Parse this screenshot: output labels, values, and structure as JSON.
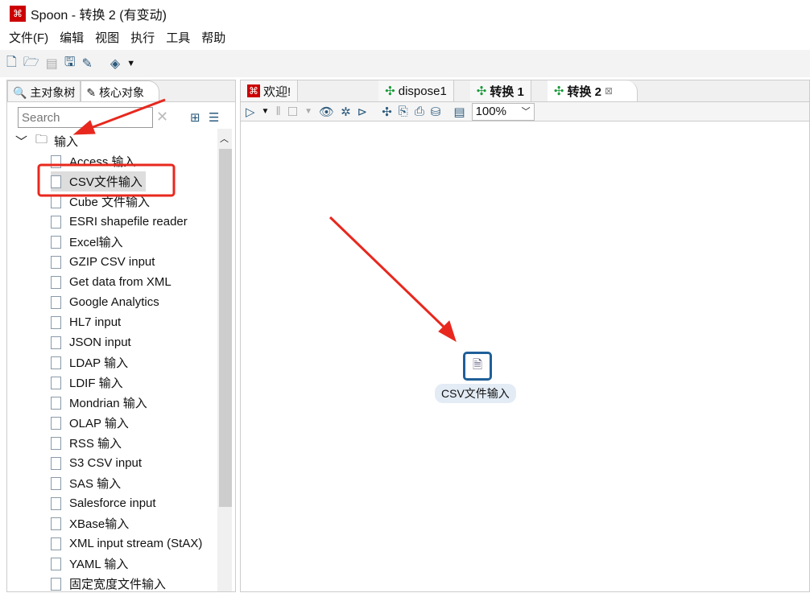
{
  "window": {
    "title": "Spoon - 转换 2 (有变动)"
  },
  "menu": [
    "文件(F)",
    "编辑",
    "视图",
    "执行",
    "工具",
    "帮助"
  ],
  "left_tabs": [
    "主对象树",
    "核心对象"
  ],
  "search": {
    "placeholder": "Search"
  },
  "tree": {
    "folder": "输入",
    "items": [
      "Access 输入",
      "CSV文件输入",
      "Cube 文件输入",
      "ESRI shapefile reader",
      "Excel输入",
      "GZIP CSV input",
      "Get data from XML",
      "Google Analytics",
      "HL7 input",
      "JSON input",
      "LDAP 输入",
      "LDIF 输入",
      "Mondrian 输入",
      "OLAP 输入",
      "RSS 输入",
      "S3 CSV input",
      "SAS 输入",
      "Salesforce input",
      "XBase输入",
      "XML input stream (StAX)",
      "YAML 输入",
      "固定宽度文件输入"
    ],
    "selected": "CSV文件输入"
  },
  "editor_tabs": [
    "欢迎!",
    "dispose1",
    "转换 1",
    "转换 2"
  ],
  "zoom": "100%",
  "canvas": {
    "step_label": "CSV文件输入"
  },
  "colors": {
    "annotation": "#e8281e",
    "step_border": "#1f5f98",
    "accent_green": "#1a9a3a"
  }
}
